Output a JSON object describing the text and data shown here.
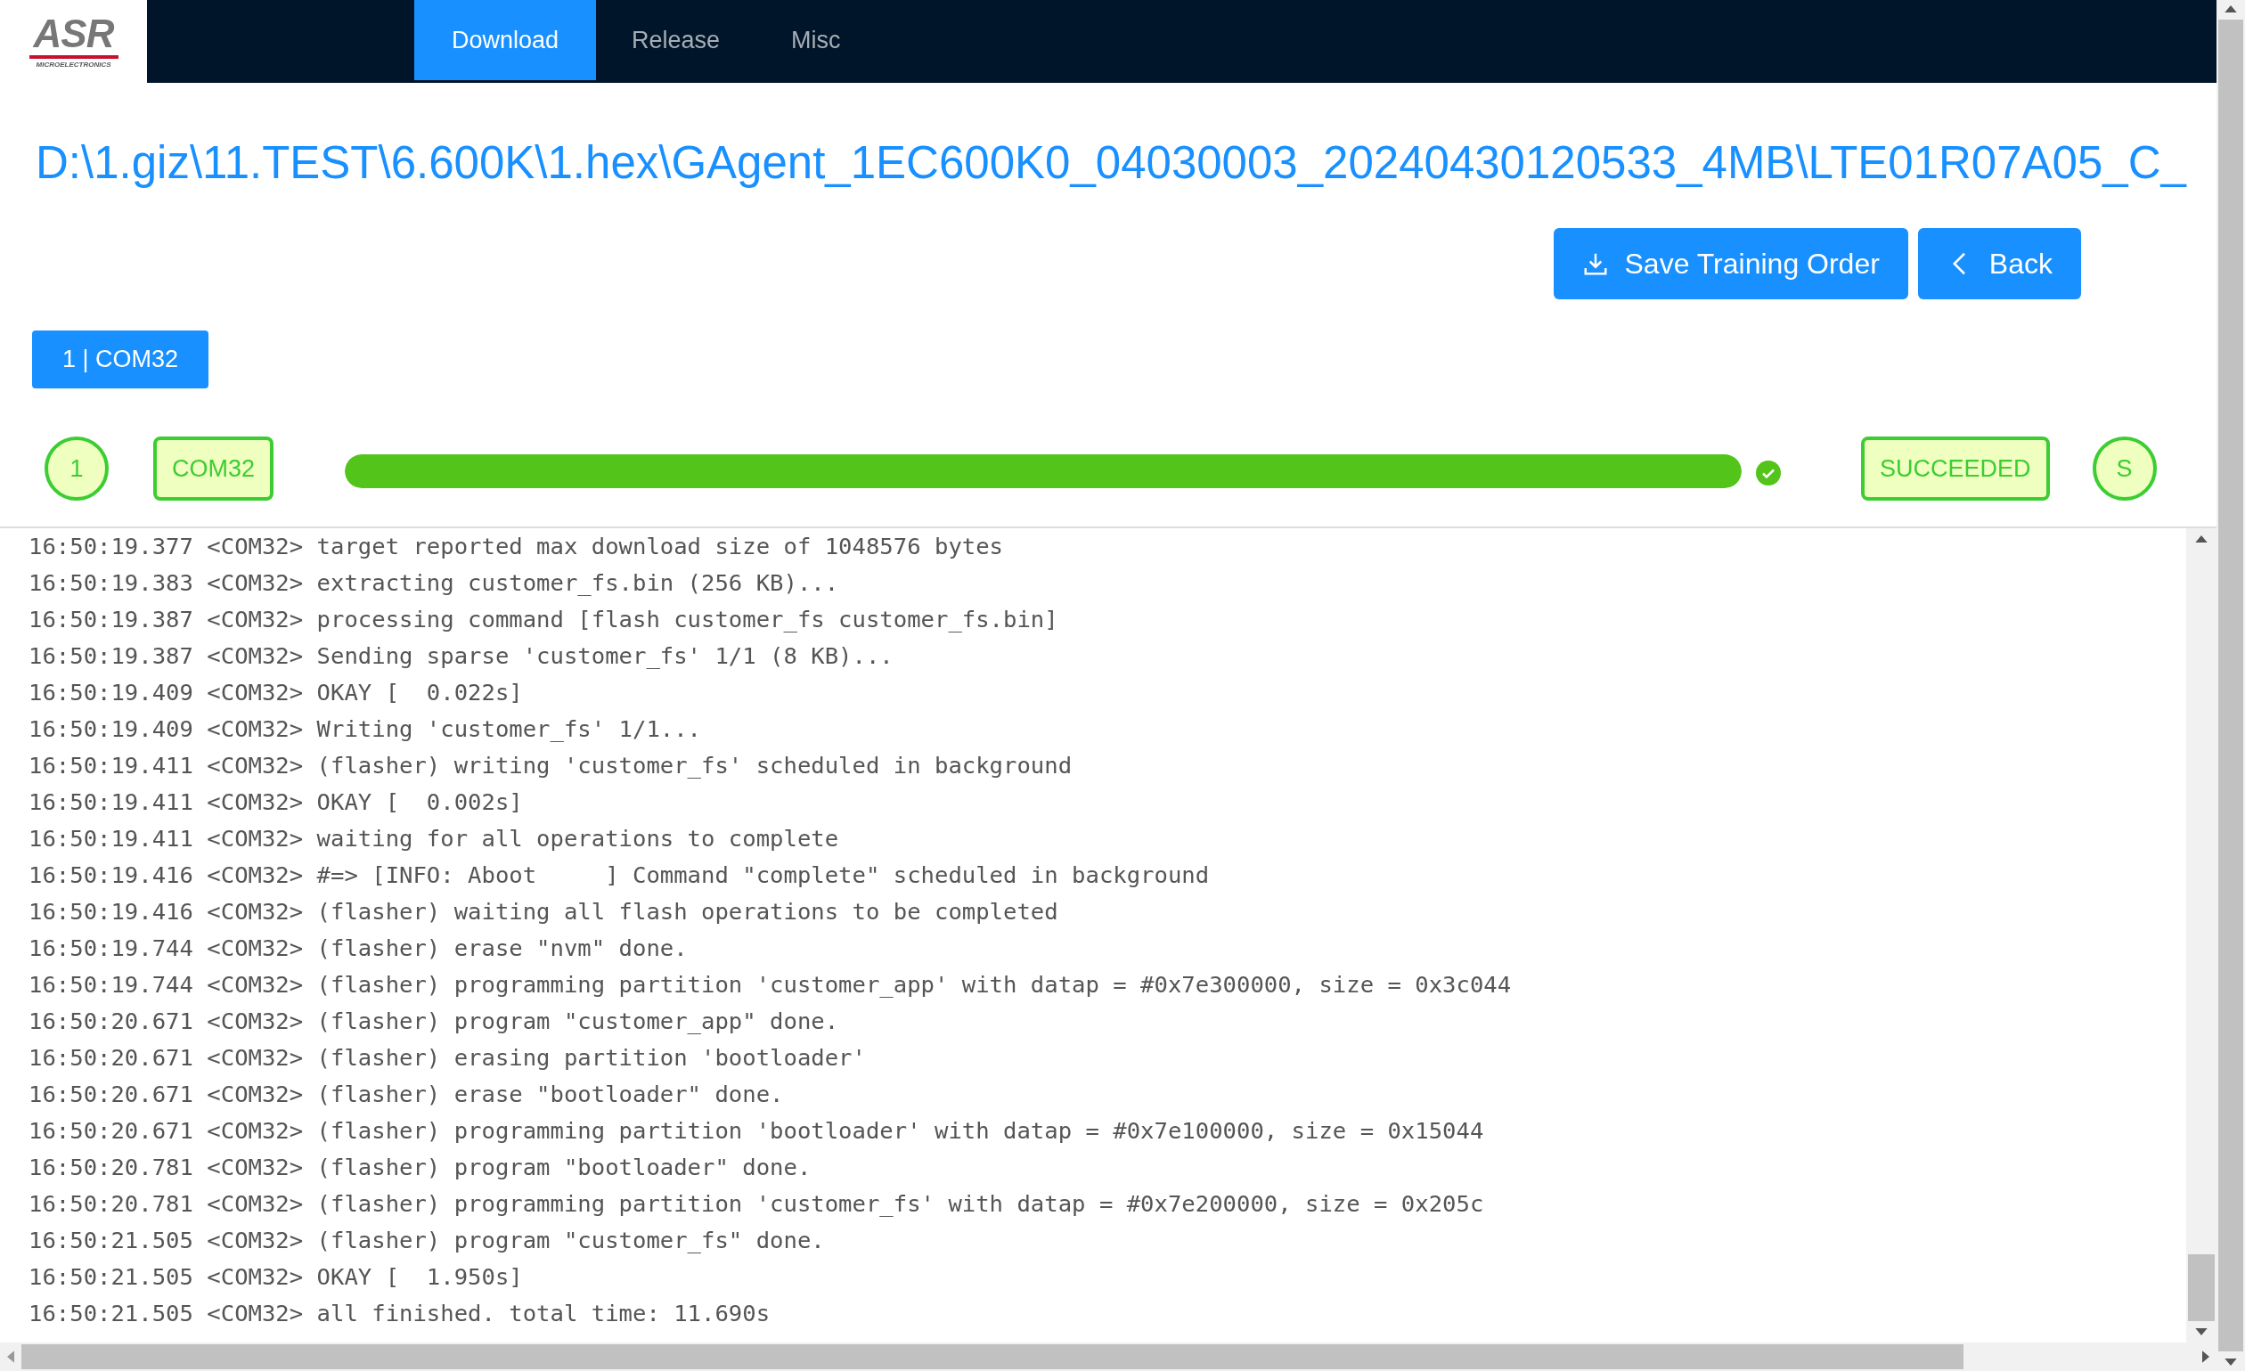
{
  "header": {
    "logo": {
      "text": "ASR",
      "subtitle": "MICROELECTRONICS"
    },
    "tabs": [
      {
        "label": "Download",
        "selected": true
      },
      {
        "label": "Release",
        "selected": false
      },
      {
        "label": "Misc",
        "selected": false
      }
    ]
  },
  "path": "D:\\1.giz\\11.TEST\\6.600K\\1.hex\\GAgent_1EC600K0_04030003_20240430120533_4MB\\LTE01R07A05_C_",
  "buttons": [
    {
      "label": "Save Training Order"
    },
    {
      "label": "Back"
    }
  ],
  "port_tabs": [
    {
      "label": "1 | COM32",
      "selected": true
    }
  ],
  "device": {
    "index": "1",
    "port": "COM32",
    "level": 1,
    "done": true,
    "status": "SUCCEEDED",
    "status_short": "S"
  },
  "log": [
    "16:50:19.377 <COM32> target reported max download size of 1048576 bytes",
    "16:50:19.383 <COM32> extracting customer_fs.bin (256 KB)...",
    "16:50:19.387 <COM32> processing command [flash customer_fs customer_fs.bin]",
    "16:50:19.387 <COM32> Sending sparse 'customer_fs' 1/1 (8 KB)...",
    "16:50:19.409 <COM32> OKAY [  0.022s]",
    "16:50:19.409 <COM32> Writing 'customer_fs' 1/1...",
    "16:50:19.411 <COM32> (flasher) writing 'customer_fs' scheduled in background",
    "16:50:19.411 <COM32> OKAY [  0.002s]",
    "16:50:19.411 <COM32> waiting for all operations to complete",
    "16:50:19.416 <COM32> #=> [INFO: Aboot     ] Command \"complete\" scheduled in background",
    "16:50:19.416 <COM32> (flasher) waiting all flash operations to be completed",
    "16:50:19.744 <COM32> (flasher) erase \"nvm\" done.",
    "16:50:19.744 <COM32> (flasher) programming partition 'customer_app' with datap = #0x7e300000, size = 0x3c044",
    "16:50:20.671 <COM32> (flasher) program \"customer_app\" done.",
    "16:50:20.671 <COM32> (flasher) erasing partition 'bootloader'",
    "16:50:20.671 <COM32> (flasher) erase \"bootloader\" done.",
    "16:50:20.671 <COM32> (flasher) programming partition 'bootloader' with datap = #0x7e100000, size = 0x15044",
    "16:50:20.781 <COM32> (flasher) program \"bootloader\" done.",
    "16:50:20.781 <COM32> (flasher) programming partition 'customer_fs' with datap = #0x7e200000, size = 0x205c",
    "16:50:21.505 <COM32> (flasher) program \"customer_fs\" done.",
    "16:50:21.505 <COM32> OKAY [  1.950s]",
    "16:50:21.505 <COM32> all finished. total time: 11.690s"
  ]
}
